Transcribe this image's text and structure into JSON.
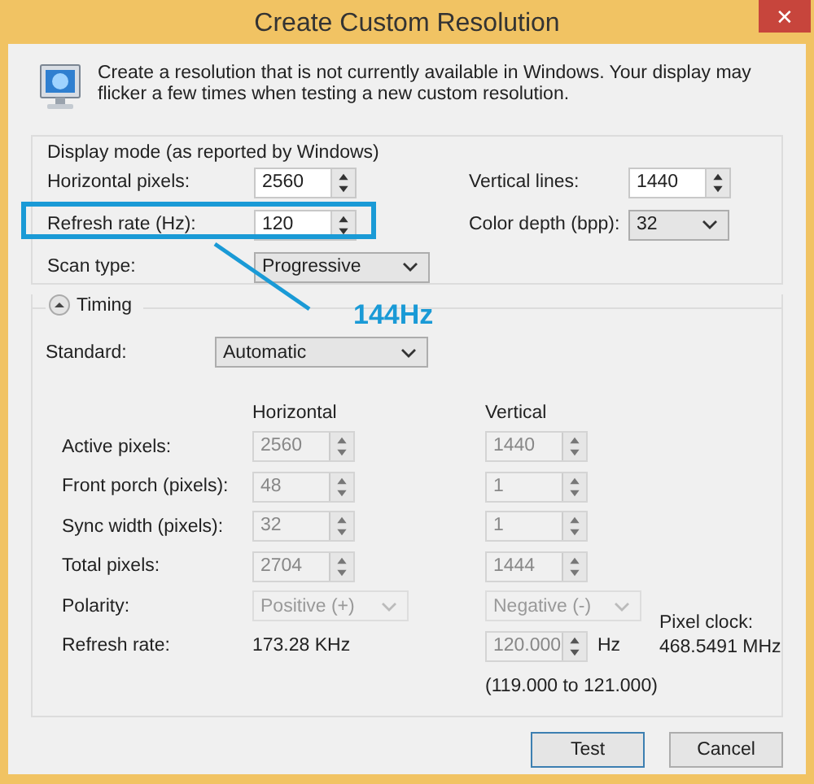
{
  "window": {
    "title": "Create Custom Resolution",
    "close": "✕"
  },
  "description": "Create a resolution that is not currently available in Windows. Your display may flicker a few times when testing a new custom resolution.",
  "display_mode": {
    "title": "Display mode (as reported by Windows)",
    "left": [
      {
        "label": "Horizontal pixels:",
        "value": "2560",
        "kind": "spin"
      },
      {
        "label": "Refresh rate (Hz):",
        "value": "120",
        "kind": "spin",
        "highlighted": true
      },
      {
        "label": "Scan type:",
        "value": "Progressive",
        "kind": "dropdown"
      }
    ],
    "right": [
      {
        "label": "Vertical lines:",
        "value": "1440",
        "kind": "spin"
      },
      {
        "label": "Color depth (bpp):",
        "value": "32",
        "kind": "dropdown"
      }
    ]
  },
  "annotation": {
    "label": "144Hz"
  },
  "timing": {
    "title": "Timing",
    "expanded": true,
    "standard": {
      "label": "Standard:",
      "value": "Automatic"
    },
    "columns": [
      "Horizontal",
      "Vertical"
    ],
    "rows": [
      {
        "label": "Active pixels:",
        "kind": "spin",
        "disabled": true,
        "horizontal": "2560",
        "vertical": "1440"
      },
      {
        "label": "Front porch (pixels):",
        "kind": "spin",
        "disabled": true,
        "horizontal": "48",
        "vertical": "1"
      },
      {
        "label": "Sync width (pixels):",
        "kind": "spin",
        "disabled": true,
        "horizontal": "32",
        "vertical": "1"
      },
      {
        "label": "Total pixels:",
        "kind": "spin",
        "disabled": true,
        "horizontal": "2704",
        "vertical": "1444"
      },
      {
        "label": "Polarity:",
        "kind": "dropdown",
        "disabled": true,
        "horizontal": "Positive (+)",
        "vertical": "Negative (-)"
      }
    ],
    "refresh": {
      "label": "Refresh rate:",
      "horizontal": "173.28 KHz",
      "vertical": "120.000",
      "disabled": true,
      "unit": "Hz",
      "range": "(119.000 to 121.000)"
    },
    "pixel_clock": {
      "label": "Pixel clock:",
      "value": "468.5491 MHz"
    }
  },
  "buttons": [
    {
      "label": "Test",
      "default": true
    },
    {
      "label": "Cancel",
      "default": false
    }
  ]
}
